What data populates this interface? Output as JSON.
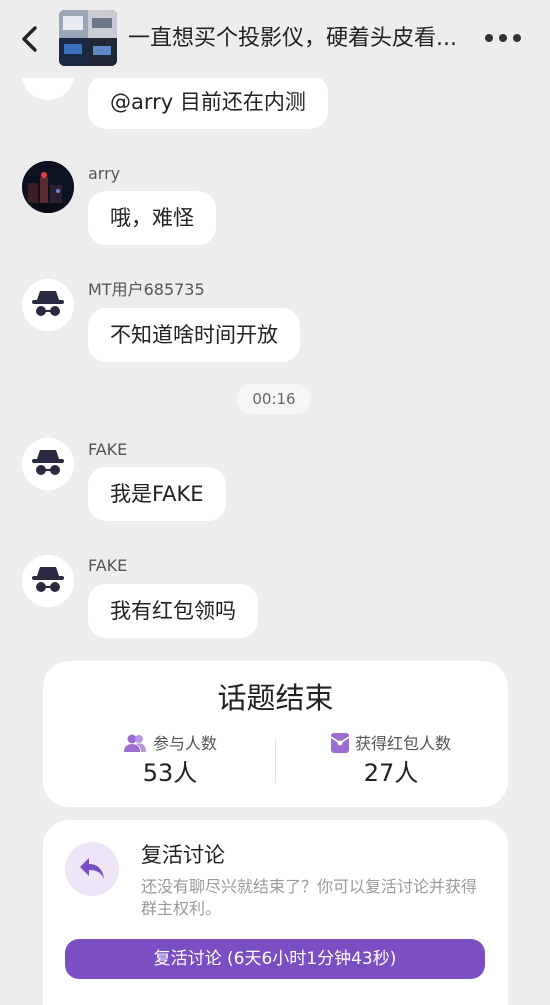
{
  "header": {
    "title": "一直想买个投影仪，硬着头皮看...",
    "back_icon": "chevron-left-icon",
    "more_icon": "more-dots-icon"
  },
  "messages": [
    {
      "sender": "",
      "text": "@arry 目前还在内测"
    },
    {
      "sender": "arry",
      "text": "哦，难怪"
    },
    {
      "sender": "MT用户685735",
      "text": "不知道啥时间开放"
    },
    {
      "time": "00:16"
    },
    {
      "sender": "FAKE",
      "text": "我是FAKE"
    },
    {
      "sender": "FAKE",
      "text": "我有红包领吗"
    }
  ],
  "topic_end": {
    "title": "话题结束",
    "participants_label": "参与人数",
    "participants_value": "53人",
    "redpacket_label": "获得红包人数",
    "redpacket_value": "27人",
    "accent_color": "#9b6fd0"
  },
  "revive": {
    "title": "复活讨论",
    "description": "还没有聊尽兴就结束了？你可以复活讨论并获得群主权利。",
    "button_label": "复活讨论 (6天6小时1分钟43秒)",
    "button_color": "#7a4fc4"
  }
}
